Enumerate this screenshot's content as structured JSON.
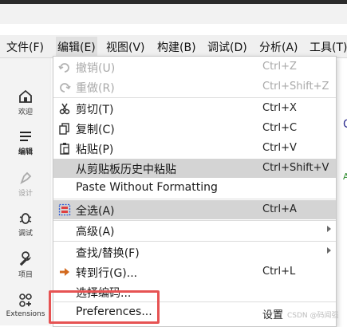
{
  "menubar": {
    "items": [
      {
        "label": "文件(F)"
      },
      {
        "label": "编辑(E)"
      },
      {
        "label": "视图(V)"
      },
      {
        "label": "构建(B)"
      },
      {
        "label": "调试(D)"
      },
      {
        "label": "分析(A)"
      },
      {
        "label": "工具(T)"
      }
    ]
  },
  "sidebar": {
    "items": [
      {
        "label": "欢迎",
        "icon": "home-icon"
      },
      {
        "label": "编辑",
        "icon": "edit-lines-icon"
      },
      {
        "label": "设计",
        "icon": "pen-icon"
      },
      {
        "label": "调试",
        "icon": "bug-icon"
      },
      {
        "label": "项目",
        "icon": "wrench-icon"
      },
      {
        "label": "Extensions",
        "icon": "extensions-icon"
      }
    ]
  },
  "edit_menu": {
    "items": [
      {
        "label": "撤销(U)",
        "shortcut": "Ctrl+Z",
        "icon": "undo-icon",
        "disabled": true
      },
      {
        "label": "重做(R)",
        "shortcut": "Ctrl+Shift+Z",
        "icon": "redo-icon",
        "disabled": true
      },
      {
        "label": "剪切(T)",
        "shortcut": "Ctrl+X",
        "icon": "scissors-icon"
      },
      {
        "label": "复制(C)",
        "shortcut": "Ctrl+C",
        "icon": "copy-icon"
      },
      {
        "label": "粘贴(P)",
        "shortcut": "Ctrl+V",
        "icon": "paste-icon"
      },
      {
        "label": "从剪贴板历史中粘贴",
        "shortcut": "Ctrl+Shift+V",
        "highlighted": true
      },
      {
        "label": "Paste Without Formatting",
        "shortcut": ""
      },
      {
        "label": "全选(A)",
        "shortcut": "Ctrl+A",
        "icon": "select-all-icon",
        "highlighted": true
      },
      {
        "label": "高级(A)",
        "submenu": true
      },
      {
        "label": "查找/替换(F)",
        "submenu": true
      },
      {
        "label": "转到行(G)...",
        "shortcut": "Ctrl+L",
        "icon": "goto-line-icon"
      },
      {
        "label": "选择编码...",
        "shortcut": ""
      },
      {
        "label": "Preferences...",
        "shortcut": "设置"
      }
    ]
  },
  "watermark": "CSDN @码闻强"
}
